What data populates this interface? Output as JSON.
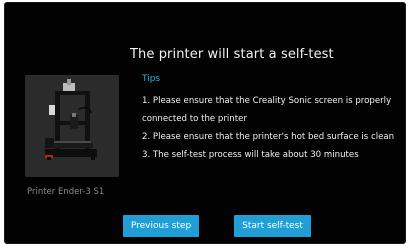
{
  "dialog": {
    "title": "The printer will start a self-test"
  },
  "printer": {
    "name": "Printer Ender-3 S1",
    "image_icon": "printer-image"
  },
  "tips": {
    "heading": "Tips",
    "items": [
      "1. Please ensure that the Creality Sonic screen is properly connected to the printer",
      "2. Please ensure that the printer's hot bed surface is clean",
      "3. The self-test process will take about 30 minutes"
    ]
  },
  "buttons": {
    "previous_label": "Previous step",
    "start_label": "Start self-test"
  },
  "colors": {
    "background": "#020202",
    "accent": "#2bb0e6",
    "button": "#1f9fd6",
    "text": "#f2f2f2",
    "muted": "#8a8a8a"
  }
}
